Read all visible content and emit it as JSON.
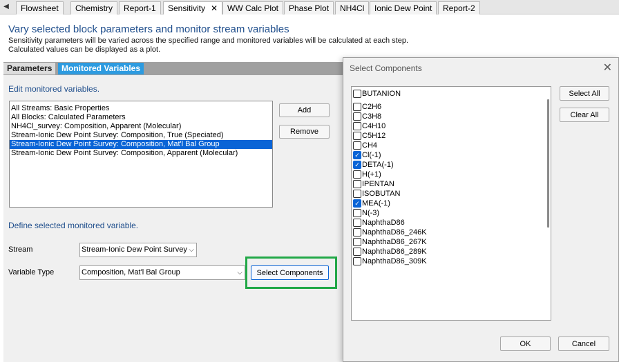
{
  "tabs": {
    "scroll_left": "◀",
    "items": [
      {
        "label": "Flowsheet"
      },
      {
        "label": "Chemistry"
      },
      {
        "label": "Report-1"
      },
      {
        "label": "Sensitivity"
      },
      {
        "label": "WW Calc Plot"
      },
      {
        "label": "Phase Plot"
      },
      {
        "label": "NH4Cl"
      },
      {
        "label": "Ionic Dew Point"
      },
      {
        "label": "Report-2"
      }
    ],
    "active_close": "✕"
  },
  "header": {
    "title": "Vary selected block parameters and monitor stream variables",
    "line1": "Sensitivity parameters will be varied across the specified range and monitored variables will be calculated at each step.",
    "line2": "Calculated values can be displayed as a plot."
  },
  "subtabs": {
    "parameters": "Parameters",
    "monitored": "Monitored Variables"
  },
  "monitored": {
    "edit_label": "Edit monitored variables.",
    "items": [
      "All Streams: Basic Properties",
      "All Blocks: Calculated Parameters",
      "NH4Cl_survey: Composition, Apparent (Molecular)",
      "Stream-Ionic Dew Point Survey: Composition, True (Speciated)",
      "Stream-Ionic Dew Point Survey: Composition, Mat'l Bal Group",
      "Stream-Ionic Dew Point Survey: Composition, Apparent (Molecular)"
    ],
    "selected_index": 4,
    "add_label": "Add",
    "remove_label": "Remove",
    "define_label": "Define selected monitored variable.",
    "stream_label": "Stream",
    "stream_value": "Stream-Ionic Dew Point Survey",
    "vartype_label": "Variable Type",
    "vartype_value": "Composition, Mat'l Bal Group",
    "select_components_label": "Select Components"
  },
  "dialog": {
    "title": "Select Components",
    "close": "✕",
    "select_all": "Select All",
    "clear_all": "Clear All",
    "ok": "OK",
    "cancel": "Cancel",
    "components": [
      {
        "name": "BUTANION",
        "checked": false
      },
      {
        "name": "C2H6",
        "checked": false
      },
      {
        "name": "C3H8",
        "checked": false
      },
      {
        "name": "C4H10",
        "checked": false
      },
      {
        "name": "C5H12",
        "checked": false
      },
      {
        "name": "CH4",
        "checked": false
      },
      {
        "name": "Cl(-1)",
        "checked": true
      },
      {
        "name": "DETA(-1)",
        "checked": true
      },
      {
        "name": "H(+1)",
        "checked": false
      },
      {
        "name": "IPENTAN",
        "checked": false
      },
      {
        "name": "ISOBUTAN",
        "checked": false
      },
      {
        "name": "MEA(-1)",
        "checked": true
      },
      {
        "name": "N(-3)",
        "checked": false
      },
      {
        "name": "NaphthaD86",
        "checked": false
      },
      {
        "name": "NaphthaD86_246K",
        "checked": false
      },
      {
        "name": "NaphthaD86_267K",
        "checked": false
      },
      {
        "name": "NaphthaD86_289K",
        "checked": false
      },
      {
        "name": "NaphthaD86_309K",
        "checked": false
      }
    ],
    "check_glyph": "✓"
  },
  "colors": {
    "accent": "#2d9be0",
    "selection": "#0a64d6",
    "heading": "#1f4e8c",
    "highlight": "#21a847"
  }
}
